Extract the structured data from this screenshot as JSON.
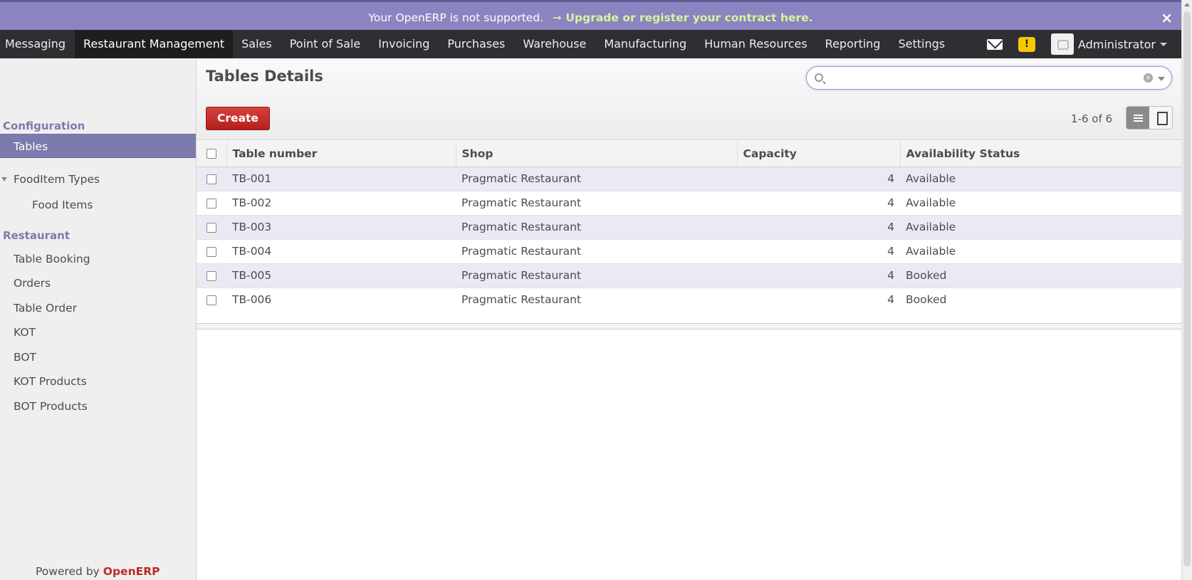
{
  "notification": {
    "message": "Your OpenERP is not supported.",
    "link": "➞ Upgrade or register your contract here.",
    "close": "×"
  },
  "topmenu": {
    "items": [
      "Messaging",
      "Restaurant Management",
      "Sales",
      "Point of Sale",
      "Invoicing",
      "Purchases",
      "Warehouse",
      "Manufacturing",
      "Human Resources",
      "Reporting",
      "Settings"
    ],
    "active": "Restaurant Management",
    "warning_glyph": "!",
    "user": "Administrator"
  },
  "sidebar": {
    "sections": [
      {
        "title": "Configuration"
      },
      {
        "title": "Restaurant"
      }
    ],
    "items": [
      {
        "label": "Tables"
      },
      {
        "label": "FoodItem Types"
      },
      {
        "label": "Food Items"
      },
      {
        "label": "Table Booking"
      },
      {
        "label": "Orders"
      },
      {
        "label": "Table Order"
      },
      {
        "label": "KOT"
      },
      {
        "label": "BOT"
      },
      {
        "label": "KOT Products"
      },
      {
        "label": "BOT Products"
      }
    ],
    "powered_by": "Powered by",
    "brand": "OpenERP"
  },
  "main": {
    "title": "Tables Details",
    "search": {
      "value": "",
      "clear": "×"
    },
    "create_label": "Create",
    "pager": "1-6 of 6",
    "columns": [
      "Table number",
      "Shop",
      "Capacity",
      "Availability Status"
    ],
    "rows": [
      {
        "table": "TB-001",
        "shop": "Pragmatic Restaurant",
        "capacity": "4",
        "status": "Available"
      },
      {
        "table": "TB-002",
        "shop": "Pragmatic Restaurant",
        "capacity": "4",
        "status": "Available"
      },
      {
        "table": "TB-003",
        "shop": "Pragmatic Restaurant",
        "capacity": "4",
        "status": "Available"
      },
      {
        "table": "TB-004",
        "shop": "Pragmatic Restaurant",
        "capacity": "4",
        "status": "Available"
      },
      {
        "table": "TB-005",
        "shop": "Pragmatic Restaurant",
        "capacity": "4",
        "status": "Booked"
      },
      {
        "table": "TB-006",
        "shop": "Pragmatic Restaurant",
        "capacity": "4",
        "status": "Booked"
      }
    ]
  },
  "colors": {
    "accent": "#7c7bad",
    "notification_bg": "#8b84c0",
    "topbar_bg": "#2f2f33",
    "create_button": "#c12c28",
    "row_stripe": "#eaeaf4"
  }
}
